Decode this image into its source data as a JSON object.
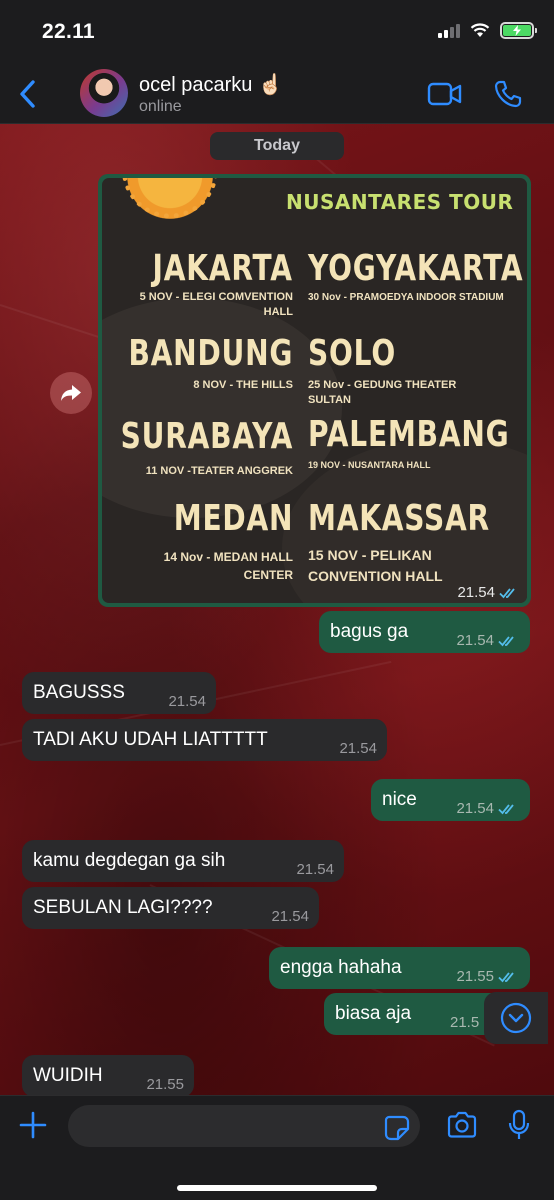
{
  "status_bar": {
    "time": "22.11"
  },
  "header": {
    "contact_name": "ocel pacarku ☝🏻",
    "contact_status": "online"
  },
  "chat": {
    "date_separator": "Today",
    "image_message": {
      "time": "21.54",
      "poster": {
        "title": "NUSANTARES TOUR",
        "cities": [
          {
            "city": "JAKARTA",
            "venue": "5 NOV - ELEGI COMVENTION HALL"
          },
          {
            "city": "YOGYAKARTA",
            "venue": "30 Nov - PRAMOEDYA INDOOR STADIUM"
          },
          {
            "city": "BANDUNG",
            "venue": "8 NOV - THE HILLS"
          },
          {
            "city": "SOLO",
            "venue": "25 Nov - GEDUNG THEATER SULTAN"
          },
          {
            "city": "SURABAYA",
            "venue": "11 NOV -TEATER ANGGREK"
          },
          {
            "city": "PALEMBANG",
            "venue": "19 NOV - NUSANTARA HALL"
          },
          {
            "city": "MEDAN",
            "venue": "14 Nov - MEDAN HALL CENTER"
          },
          {
            "city": "MAKASSAR",
            "venue": "15 NOV - PELIKAN CONVENTION HALL"
          }
        ]
      }
    },
    "messages": [
      {
        "direction": "out",
        "text": "bagus ga",
        "time": "21.54",
        "read": true
      },
      {
        "direction": "in",
        "text": "BAGUSSS",
        "time": "21.54"
      },
      {
        "direction": "in",
        "text": "TADI AKU UDAH LIATTTTT",
        "time": "21.54"
      },
      {
        "direction": "out",
        "text": "nice",
        "time": "21.54",
        "read": true
      },
      {
        "direction": "in",
        "text": "kamu degdegan ga sih",
        "time": "21.54"
      },
      {
        "direction": "in",
        "text": "SEBULAN LAGI????",
        "time": "21.54"
      },
      {
        "direction": "out",
        "text": "engga hahaha",
        "time": "21.55",
        "read": true
      },
      {
        "direction": "out",
        "text": "biasa aja",
        "time": "21.5",
        "read": false
      },
      {
        "direction": "in",
        "text": "WUIDIH",
        "time": "21.55"
      }
    ]
  },
  "colors": {
    "outgoing_bubble": "#1f5a42",
    "incoming_bubble": "#2a2a2c",
    "accent_blue": "#2f8cff",
    "read_ticks": "#53bdeb",
    "chat_background": "#6f1216"
  },
  "icons": {
    "back": "chevron-left-icon",
    "video": "video-camera-icon",
    "call": "phone-icon",
    "forward": "forward-arrow-icon",
    "scroll_down": "chevron-down-circle-icon",
    "attach": "plus-icon",
    "sticker": "sticker-icon",
    "camera": "camera-icon",
    "mic": "microphone-icon"
  }
}
